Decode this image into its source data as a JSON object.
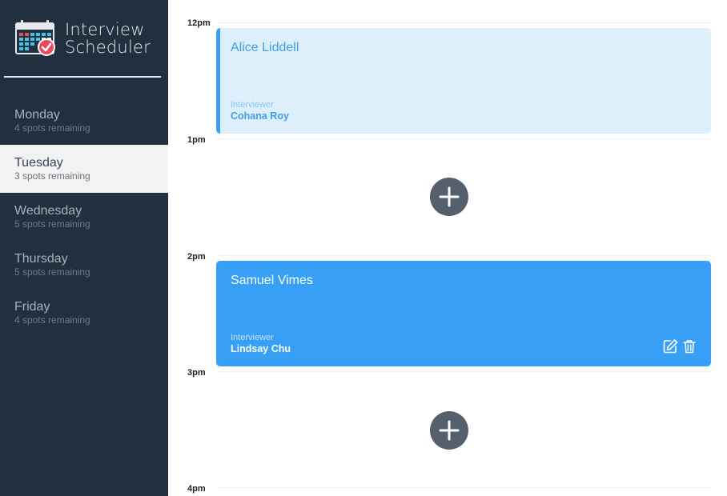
{
  "app": {
    "title_line1": "Interview",
    "title_line2": "Scheduler",
    "logo_icon": "calendar-check-icon"
  },
  "days": [
    {
      "name": "Monday",
      "spots": "4 spots remaining",
      "selected": false
    },
    {
      "name": "Tuesday",
      "spots": "3 spots remaining",
      "selected": true
    },
    {
      "name": "Wednesday",
      "spots": "5 spots remaining",
      "selected": false
    },
    {
      "name": "Thursday",
      "spots": "5 spots remaining",
      "selected": false
    },
    {
      "name": "Friday",
      "spots": "4 spots remaining",
      "selected": false
    }
  ],
  "times": [
    "12pm",
    "1pm",
    "2pm",
    "3pm",
    "4pm"
  ],
  "appointments": [
    {
      "student": "Alice Liddell",
      "interviewer_label": "Interviewer",
      "interviewer": "Cohana Roy",
      "state": "default"
    },
    {
      "student": "Samuel Vimes",
      "interviewer_label": "Interviewer",
      "interviewer": "Lindsay Chu",
      "state": "hover",
      "actions": [
        "edit-icon",
        "trash-icon"
      ]
    }
  ],
  "empty_slot_icon": "plus-icon",
  "colors": {
    "sidebar": "#222f3e",
    "selected_day": "#f2f2f2",
    "appointment_light": "#deeffc",
    "appointment_active": "#379ff5",
    "accent": "#3ba0f5",
    "add_button": "#54606d"
  }
}
